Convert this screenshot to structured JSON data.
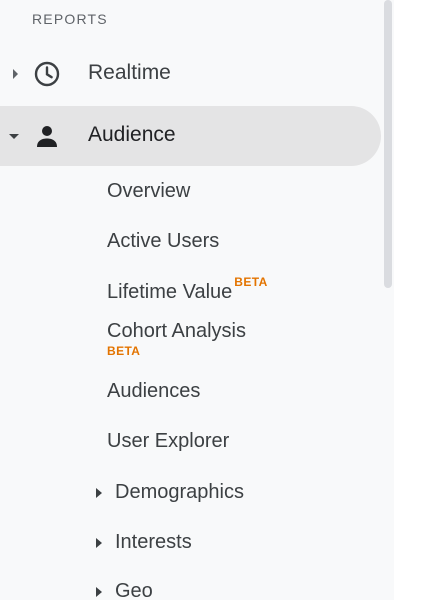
{
  "section": {
    "label": "REPORTS"
  },
  "reports": [
    {
      "label": "Realtime",
      "icon": "clock-icon",
      "expanded": false
    },
    {
      "label": "Audience",
      "icon": "person-icon",
      "expanded": true,
      "selected": true
    }
  ],
  "audience_items": [
    {
      "label": "Overview"
    },
    {
      "label": "Active Users"
    },
    {
      "label": "Lifetime Value",
      "badge": "BETA"
    },
    {
      "label": "Cohort Analysis",
      "badge": "BETA"
    },
    {
      "label": "Audiences"
    },
    {
      "label": "User Explorer"
    },
    {
      "label": "Demographics",
      "expandable": true
    },
    {
      "label": "Interests",
      "expandable": true
    },
    {
      "label": "Geo",
      "expandable": true
    }
  ],
  "colors": {
    "panel_bg": "#f8f9fa",
    "selected_bg": "#e4e4e5",
    "text": "#3c4043",
    "beta": "#e37400",
    "scrollbar": "#dadce0"
  }
}
